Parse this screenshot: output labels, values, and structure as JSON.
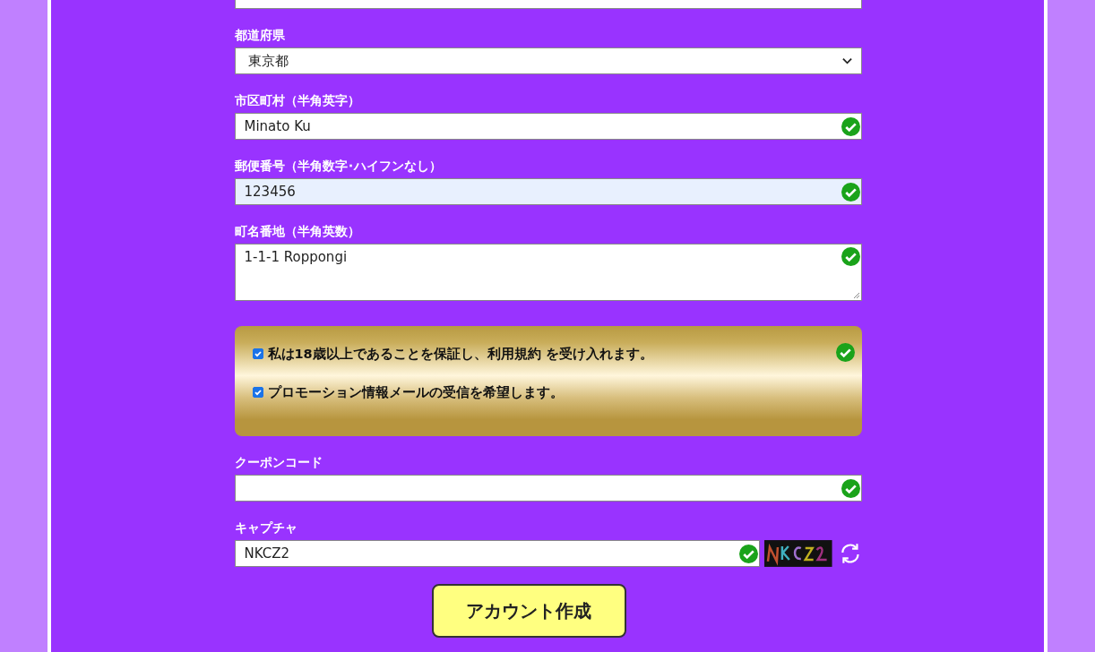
{
  "fields": [
    {
      "kind": "select",
      "label": "都道府県",
      "value": "東京都"
    },
    {
      "kind": "input",
      "label": "市区町村（半角英字）",
      "value": "Minato Ku",
      "valid": true
    },
    {
      "kind": "input",
      "label": "郵便番号（半角数字･ハイフンなし）",
      "value": "123456",
      "valid": true,
      "autofilled": true
    },
    {
      "kind": "textarea",
      "label": "町名番地（半角英数）",
      "value": "1-1-1 Roppongi",
      "valid": true
    }
  ],
  "agreements": {
    "valid": true,
    "items": [
      {
        "text": "私は18歳以上であることを保証し、利用規約 を受け入れます。",
        "checked": true
      },
      {
        "text": "プロモーション情報メールの受信を希望します。",
        "checked": true
      }
    ]
  },
  "coupon": {
    "label": "クーポンコード",
    "valid": true
  },
  "captcha": {
    "label": "キャプチャ",
    "value": "NKCZ2",
    "valid": true
  },
  "submit": "アカウント作成"
}
